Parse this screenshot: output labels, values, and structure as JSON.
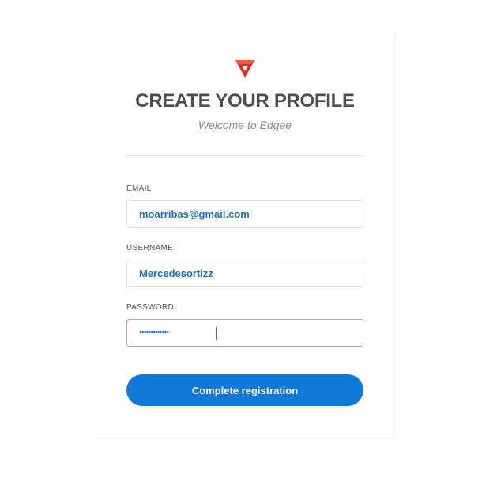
{
  "header": {
    "logo_icon": "edgee-logo-icon",
    "title": "CREATE YOUR PROFILE",
    "subtitle": "Welcome to Edgee"
  },
  "form": {
    "email": {
      "label": "EMAIL",
      "value": "moarribas@gmail.com"
    },
    "username": {
      "label": "USERNAME",
      "value": "Mercedesortizz"
    },
    "password": {
      "label": "PASSWORD",
      "masked_value": "•••••••••••••",
      "focused": true
    },
    "submit_label": "Complete registration"
  },
  "colors": {
    "accent": "#0f78d9",
    "input_text": "#1d6fc4",
    "title": "#4d4d4d",
    "logo_red": "#e8291c"
  }
}
